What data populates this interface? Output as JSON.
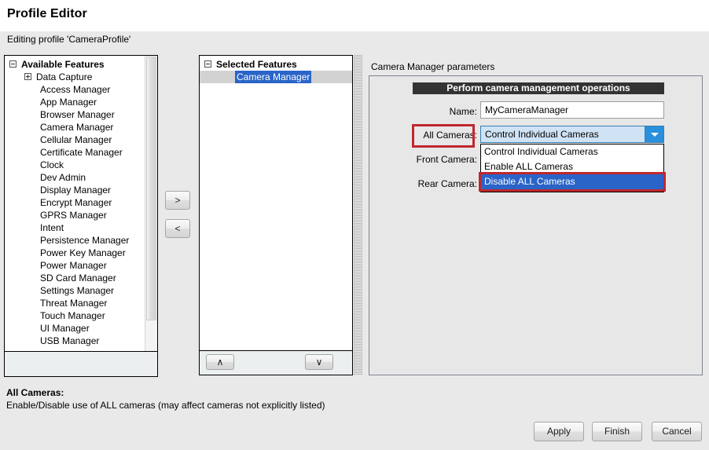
{
  "header": {
    "title": "Profile Editor",
    "subtitle": "Editing profile 'CameraProfile'"
  },
  "available_features": {
    "root_label": "Available Features",
    "items": [
      {
        "label": "Data Capture",
        "expandable": true
      },
      {
        "label": "Access Manager",
        "expandable": false
      },
      {
        "label": "App Manager",
        "expandable": false
      },
      {
        "label": "Browser Manager",
        "expandable": false
      },
      {
        "label": "Camera Manager",
        "expandable": false
      },
      {
        "label": "Cellular Manager",
        "expandable": false
      },
      {
        "label": "Certificate Manager",
        "expandable": false
      },
      {
        "label": "Clock",
        "expandable": false
      },
      {
        "label": "Dev Admin",
        "expandable": false
      },
      {
        "label": "Display Manager",
        "expandable": false
      },
      {
        "label": "Encrypt Manager",
        "expandable": false
      },
      {
        "label": "GPRS Manager",
        "expandable": false
      },
      {
        "label": "Intent",
        "expandable": false
      },
      {
        "label": "Persistence Manager",
        "expandable": false
      },
      {
        "label": "Power Key Manager",
        "expandable": false
      },
      {
        "label": "Power Manager",
        "expandable": false
      },
      {
        "label": "SD Card Manager",
        "expandable": false
      },
      {
        "label": "Settings Manager",
        "expandable": false
      },
      {
        "label": "Threat Manager",
        "expandable": false
      },
      {
        "label": "Touch Manager",
        "expandable": false
      },
      {
        "label": "UI Manager",
        "expandable": false
      },
      {
        "label": "USB Manager",
        "expandable": false
      }
    ]
  },
  "transfer": {
    "add_label": ">",
    "remove_label": "<"
  },
  "selected_features": {
    "root_label": "Selected Features",
    "items": [
      {
        "label": "Camera Manager",
        "selected": true
      }
    ],
    "move_up_label": "∧",
    "move_down_label": "∨"
  },
  "params": {
    "title": "Camera Manager parameters",
    "group_header": "Perform camera management operations",
    "fields": [
      {
        "label": "Name:",
        "value": "MyCameraManager",
        "type": "text"
      },
      {
        "label": "All Cameras:",
        "value": "Control Individual Cameras",
        "type": "combo"
      },
      {
        "label": "Front Camera:",
        "value": "",
        "type": "combo"
      },
      {
        "label": "Rear Camera:",
        "value": "",
        "type": "combo"
      }
    ],
    "dropdown": {
      "open": true,
      "options": [
        "Control Individual Cameras",
        "Enable ALL Cameras",
        "Disable ALL Cameras"
      ],
      "highlighted": "Disable ALL Cameras"
    }
  },
  "description": {
    "title": "All Cameras:",
    "body": "Enable/Disable use of ALL cameras (may affect cameras not explicitly listed)"
  },
  "footer": {
    "apply_label": "Apply",
    "finish_label": "Finish",
    "cancel_label": "Cancel"
  },
  "colors": {
    "annotation_red": "#c0272d",
    "selection_blue": "#2a64c8",
    "combo_blue": "#2a8fdd",
    "header_dark": "#333333"
  }
}
